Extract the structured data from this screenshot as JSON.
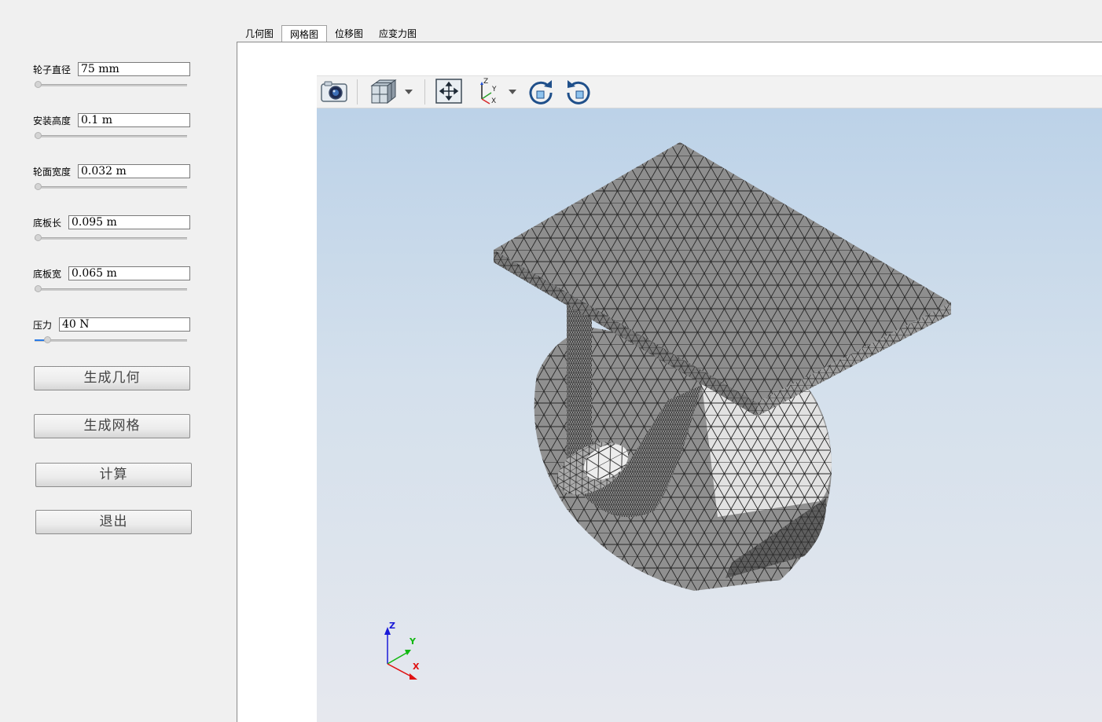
{
  "params": [
    {
      "label": "轮子直径",
      "value": "75 mm"
    },
    {
      "label": "安装高度",
      "value": "0.1 m"
    },
    {
      "label": "轮面宽度",
      "value": "0.032 m"
    },
    {
      "label": "底板长",
      "value": "0.095 m"
    },
    {
      "label": "底板宽",
      "value": "0.065 m"
    },
    {
      "label": "压力",
      "value": "40 N"
    }
  ],
  "sliders": {
    "pressure_level": 0.05
  },
  "buttons": {
    "generate_geometry": "生成几何",
    "generate_mesh": "生成网格",
    "compute": "计算",
    "exit": "退出"
  },
  "tabs": [
    {
      "label": "几何图",
      "active": false
    },
    {
      "label": "网格图",
      "active": true
    },
    {
      "label": "位移图",
      "active": false
    },
    {
      "label": "应变力图",
      "active": false
    }
  ],
  "toolbar": {
    "icons": [
      "camera-icon",
      "view-cube-icon",
      "dropdown-arrow-icon",
      "fit-all-icon",
      "axes-orientation-icon",
      "dropdown-arrow-icon",
      "rotate-clockwise-icon",
      "rotate-counterclockwise-icon"
    ]
  },
  "axis_triad": {
    "x": "X",
    "y": "Y",
    "z": "Z"
  },
  "colors": {
    "viewport_top": "#bcd2e8",
    "viewport_bottom": "#e6e8ee",
    "mesh_fill": "#8f8f8f",
    "mesh_line": "#2a2a2a",
    "axis_x": "#e01010",
    "axis_y": "#10c010",
    "axis_z": "#1010e0"
  }
}
